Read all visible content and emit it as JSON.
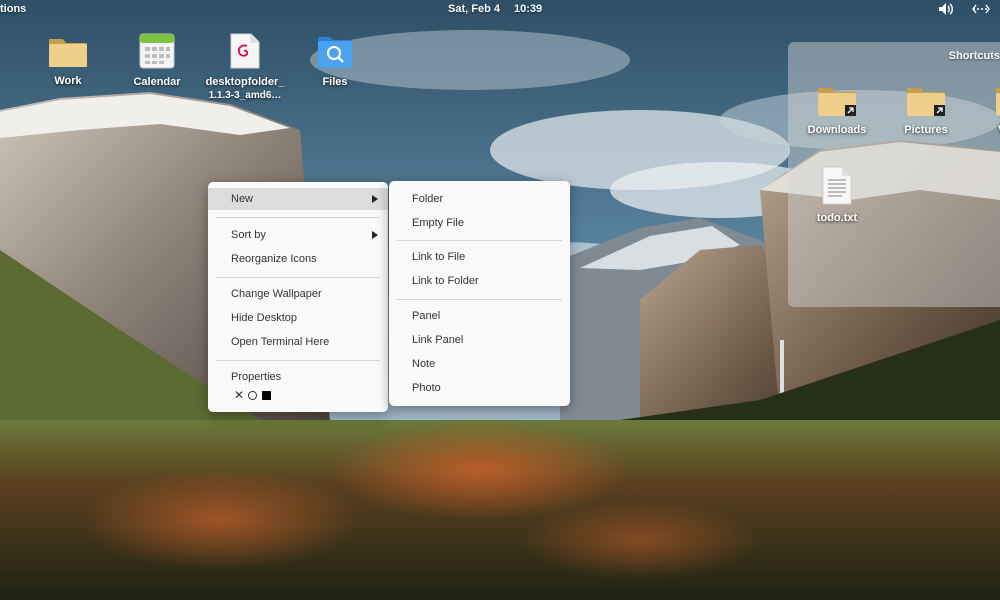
{
  "top_panel": {
    "applications_label": "tions",
    "date": "Sat, Feb  4",
    "time": "10:39",
    "volume_icon": "volume-icon",
    "network_icon": "network-wired-icon"
  },
  "desktop_icons": [
    {
      "label": "Work",
      "icon": "folder-icon"
    },
    {
      "label": "Calendar",
      "icon": "calendar-icon"
    },
    {
      "label_line1": "desktopfolder_",
      "label_line2": "1.1.3-3_amd6…",
      "icon": "debian-package-icon"
    },
    {
      "label": "Files",
      "icon": "files-icon"
    }
  ],
  "shortcuts": {
    "title": "Shortcuts",
    "items": [
      {
        "label": "Downloads",
        "icon": "folder-link-icon"
      },
      {
        "label": "Pictures",
        "icon": "folder-link-icon"
      },
      {
        "label": "V",
        "icon": "folder-link-icon"
      },
      {
        "label": "todo.txt",
        "icon": "text-file-icon"
      }
    ]
  },
  "context_menu": {
    "items": {
      "new": "New",
      "sort_by": "Sort by",
      "reorganize_icons": "Reorganize Icons",
      "change_wallpaper": "Change Wallpaper",
      "hide_desktop": "Hide Desktop",
      "open_terminal": "Open Terminal Here",
      "properties": "Properties"
    },
    "swatches": {
      "none_symbol": "✕",
      "colors": [
        "#ffffff",
        "#000000"
      ]
    }
  },
  "new_submenu": {
    "items": {
      "folder": "Folder",
      "empty_file": "Empty File",
      "link_to_file": "Link to File",
      "link_to_folder": "Link to Folder",
      "panel": "Panel",
      "link_panel": "Link Panel",
      "note": "Note",
      "photo": "Photo"
    }
  },
  "colors": {
    "menu_background": "#fafafa",
    "menu_highlight": "#dcdcdc",
    "folder_color": "#e8c47a",
    "files_icon_color": "#3a8ee6"
  }
}
